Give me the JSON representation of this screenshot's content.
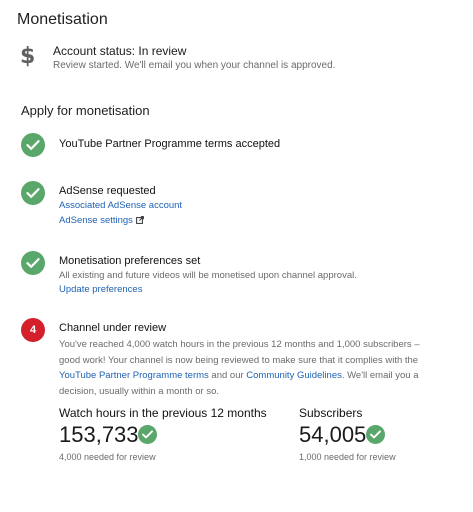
{
  "page": {
    "title": "Monetisation"
  },
  "account_status": {
    "icon": "dollar-icon",
    "title": "Account status: In review",
    "subtitle": "Review started. We'll email you when your channel is approved."
  },
  "apply": {
    "title": "Apply for monetisation",
    "steps": [
      {
        "title": "YouTube Partner Programme terms accepted"
      },
      {
        "title": "AdSense requested",
        "link1": "Associated AdSense account",
        "link2": "AdSense settings"
      },
      {
        "title": "Monetisation preferences set",
        "description": "All existing and future videos will be monetised upon channel approval.",
        "link": "Update preferences"
      },
      {
        "number": "4",
        "title": "Channel under review",
        "text_before": "You've reached 4,000 watch hours in the previous 12 months and 1,000 subscribers – good work! Your channel is now being reviewed to make sure that it complies with the ",
        "link1": "YouTube Partner Programme terms",
        "text_middle": " and our ",
        "link2": "Community Guidelines",
        "text_after": ". We'll email you a decision, usually within a month or so."
      }
    ]
  },
  "metrics": {
    "watch_hours": {
      "label": "Watch hours in the previous 12 months",
      "value": "153,733",
      "note": "4,000 needed for review"
    },
    "subscribers": {
      "label": "Subscribers",
      "value": "54,005",
      "note": "1,000 needed for review"
    }
  },
  "colors": {
    "check_green": "#5aa76b",
    "step_red": "#d3202a",
    "link_blue": "#1f62b4"
  }
}
